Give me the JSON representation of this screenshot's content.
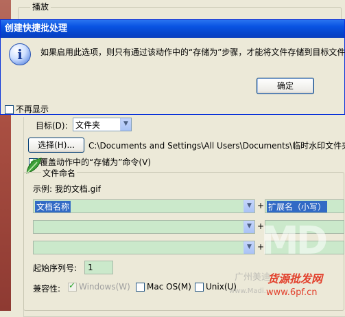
{
  "background_group": {
    "label": "播放"
  },
  "dialog": {
    "title": "创建快捷批处理",
    "message": "如果启用此选项，则只有通过该动作中的“存储为”步骤，才能将文件存储到目标文件",
    "ok_label": "确定",
    "dont_show_label": "不再显示",
    "dont_show_checked": false
  },
  "destination": {
    "target_label": "目标(D):",
    "target_value": "文件夹",
    "choose_label": "选择(H)...",
    "path": "C:\\Documents and Settings\\All Users\\Documents\\临时水印文件夹\\",
    "override_label": "覆盖动作中的“存储为”命令(V)",
    "override_checked": true
  },
  "file_naming": {
    "group_label": "文件命名",
    "example": "示例: 我的文档.gif",
    "rows": [
      {
        "left": "文档名称",
        "right": "扩展名（小写）"
      },
      {
        "left": "",
        "right": ""
      },
      {
        "left": "",
        "right": ""
      }
    ],
    "plus": "+",
    "start_serial_label": "起始序列号:",
    "start_serial_value": "1",
    "compat_label": "兼容性:",
    "compat": [
      {
        "label": "Windows(W)",
        "checked": true,
        "disabled": true
      },
      {
        "label": "Mac OS(M)",
        "checked": false,
        "disabled": false
      },
      {
        "label": "Unix(U)",
        "checked": false,
        "disabled": false
      }
    ]
  },
  "watermark": {
    "logo": "MD",
    "text_cn": "广州美迪",
    "brand": "货源批发网",
    "site_small": "www.Madi...",
    "url": "www.6pf.cn"
  },
  "colors": {
    "title_bar": "#0a54e3",
    "field_green": "#cbe9cb",
    "selection": "#316ac5"
  }
}
